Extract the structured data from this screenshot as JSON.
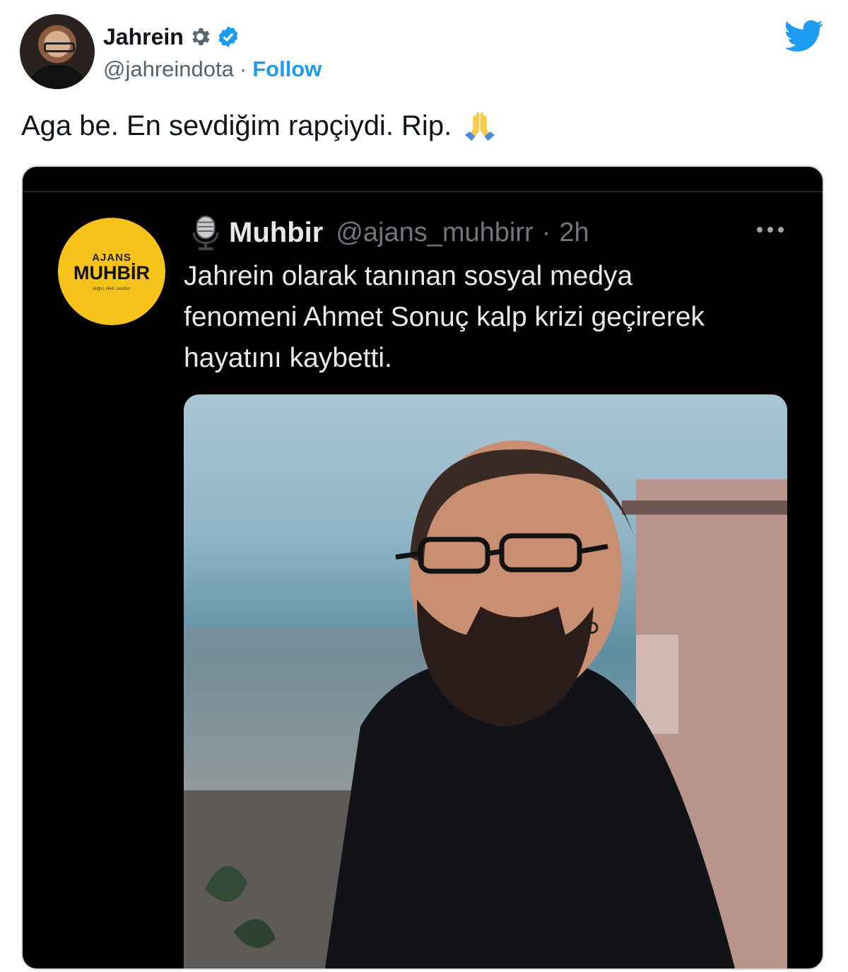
{
  "tweet": {
    "author": {
      "display_name": "Jahrein",
      "handle": "@jahreindota",
      "separator": "·",
      "follow_label": "Follow",
      "badges": [
        "gear-icon",
        "verified-icon"
      ]
    },
    "text": "Aga be. En sevdiğim rapçiydi. Rip.",
    "emoji": "folded-hands-icon",
    "brand_icon": "twitter-bird-icon"
  },
  "quoted": {
    "logo_text_top": "AJANS",
    "logo_text_main": "MUHBİR",
    "logo_tagline": "doğru, ilkeli, tarafsız",
    "name": "Muhbir",
    "handle": "@ajans_muhbirr",
    "separator": "·",
    "time": "2h",
    "text": "Jahrein olarak tanınan sosyal medya fenomeni Ahmet Sonuç kalp krizi geçirerek hayatını kaybetti.",
    "image": "photo of a bearded man with glasses in a black hoodie"
  },
  "colors": {
    "accent": "#1d9bf0",
    "logo_yellow": "#f7c21a",
    "dark_bg": "#000000"
  }
}
